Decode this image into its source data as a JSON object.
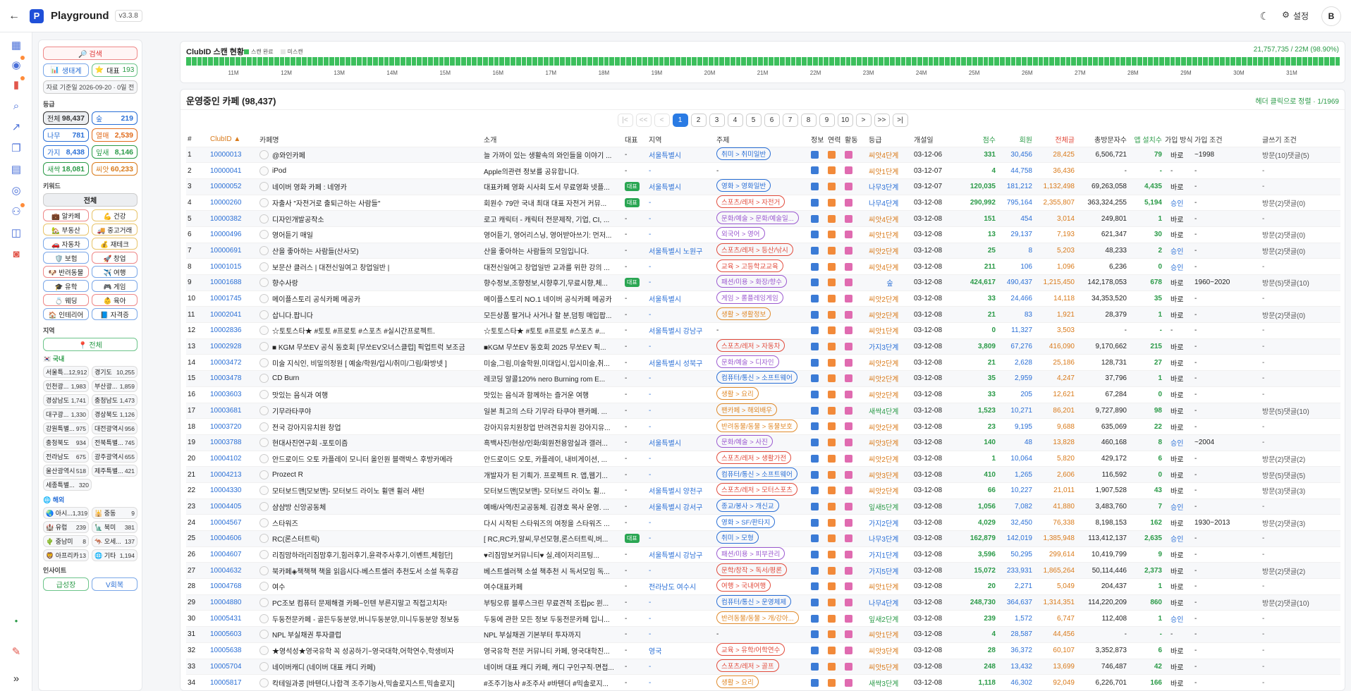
{
  "header": {
    "title": "Playground",
    "version": "v3.3.8",
    "settings_label": "설정",
    "avatar": "B"
  },
  "sidebar": {
    "search_label": "🔎 검색",
    "ecosystem_label": "생태계",
    "rep_label": "대표",
    "rep_count": "193",
    "data_date": "자료 기준일 2026-09-20 · 0일 전",
    "grade_title": "등급",
    "grades": [
      {
        "name": "전체",
        "count": "98,437",
        "color": "#333"
      },
      {
        "name": "숲",
        "count": "219",
        "color": "#2a6fd6"
      },
      {
        "name": "나무",
        "count": "781",
        "color": "#2a6fd6"
      },
      {
        "name": "열매",
        "count": "2,539",
        "color": "#e06a1a"
      },
      {
        "name": "가지",
        "count": "8,438",
        "color": "#2a6fd6"
      },
      {
        "name": "잎새",
        "count": "8,146",
        "color": "#2a9a47"
      },
      {
        "name": "새싹",
        "count": "18,081",
        "color": "#2a9a47"
      },
      {
        "name": "씨앗",
        "count": "60,233",
        "color": "#d97a1a"
      }
    ],
    "keyword_title": "키워드",
    "keyword_all": "전체",
    "keywords": [
      "💼 알카페",
      "💪 건강",
      "🏡 부동산",
      "🚚 중고거래",
      "🚗 자동차",
      "💰 재테크",
      "🛡️ 보험",
      "🚀 창업",
      "🐶 반려동물",
      "✈️ 여행",
      "🎓 유학",
      "🎮 게임",
      "💍 웨딩",
      "👶 육아",
      "🏠 인테리어",
      "📘 자격증"
    ],
    "region_title": "지역",
    "region_all": "📍 전체",
    "domestic_title": "🇰🇷 국내",
    "domestic": [
      {
        "name": "서울특...",
        "count": "12,912"
      },
      {
        "name": "경기도",
        "count": "10,255"
      },
      {
        "name": "인천광...",
        "count": "1,983"
      },
      {
        "name": "부산광...",
        "count": "1,859"
      },
      {
        "name": "경상남도",
        "count": "1,741"
      },
      {
        "name": "충청남도",
        "count": "1,473"
      },
      {
        "name": "대구광...",
        "count": "1,330"
      },
      {
        "name": "경상북도",
        "count": "1,126"
      },
      {
        "name": "강원특별...",
        "count": "975"
      },
      {
        "name": "대전광역시",
        "count": "956"
      },
      {
        "name": "충청북도",
        "count": "934"
      },
      {
        "name": "전북특별...",
        "count": "745"
      },
      {
        "name": "전라남도",
        "count": "675"
      },
      {
        "name": "광주광역시",
        "count": "655"
      },
      {
        "name": "울산광역시",
        "count": "518"
      },
      {
        "name": "제주특별...",
        "count": "421"
      },
      {
        "name": "세종특별...",
        "count": "320"
      }
    ],
    "overseas_title": "🌐 해외",
    "overseas": [
      {
        "name": "🌏 아시...",
        "count": "1,319"
      },
      {
        "name": "🕌 중동",
        "count": "9"
      },
      {
        "name": "🏰 유럽",
        "count": "239"
      },
      {
        "name": "🗽 북미",
        "count": "381"
      },
      {
        "name": "🌵 중남미",
        "count": "8"
      },
      {
        "name": "🦘 오세...",
        "count": "137"
      },
      {
        "name": "🦁 아프리카",
        "count": "13"
      },
      {
        "name": "🌐 기타",
        "count": "1,194"
      }
    ],
    "insight_title": "인사이트",
    "insight_buttons": [
      "급성장",
      "V회복"
    ]
  },
  "scan": {
    "title": "ClubID 스캔 현황",
    "legend_done": "스캔 완료",
    "legend_miss": "미스캔",
    "count": "21,757,735 / 22M (98.90%)",
    "ticks": [
      "11M",
      "12M",
      "13M",
      "14M",
      "15M",
      "16M",
      "17M",
      "18M",
      "19M",
      "20M",
      "21M",
      "22M",
      "23M",
      "24M",
      "25M",
      "26M",
      "27M",
      "28M",
      "29M",
      "30M",
      "31M"
    ]
  },
  "main": {
    "title": "운영중인 카페 (98,437)",
    "sort_hint": "헤더 클릭으로 정렬 · 1/1969",
    "pager": [
      "|<",
      "<<",
      "<",
      "1",
      "2",
      "3",
      "4",
      "5",
      "6",
      "7",
      "8",
      "9",
      "10",
      ">",
      ">>",
      ">|"
    ],
    "columns": [
      "#",
      "ClubID ▲",
      "카페명",
      "소개",
      "대표",
      "지역",
      "주제",
      "정보",
      "연력",
      "활동",
      "등급",
      "개설일",
      "점수",
      "회원",
      "전체글",
      "총방문자수",
      "앱 설치수",
      "가입 방식",
      "가입 조건",
      "글쓰기 조건"
    ],
    "rows": [
      [
        "1",
        "10000013",
        "@와인카페",
        "늘 가까이 있는 생활속의 와인들을 이야기 ...",
        "-",
        "서울특별시",
        "취미 > 취미일반",
        "씨앗4단계",
        "03-12-06",
        "331",
        "30,456",
        "28,425",
        "6,506,721",
        "79",
        "바로",
        "~1998",
        "방문(10)댓글(5)"
      ],
      [
        "2",
        "10000041",
        "iPod",
        "Apple의관련 정보를 공유합니다.",
        "-",
        "-",
        "-",
        "씨앗1단계",
        "03-12-07",
        "4",
        "44,758",
        "36,436",
        "-",
        "-",
        "-",
        "-",
        "-"
      ],
      [
        "3",
        "10000052",
        "네이버 영화 카페 : 네영카",
        "대표카페 영화 시사회 도서 무료영화 넷플...",
        "대표",
        "서울특별시",
        "영화 > 영화일반",
        "나무3단계",
        "03-12-07",
        "120,035",
        "181,212",
        "1,132,498",
        "69,263,058",
        "4,435",
        "바로",
        "-",
        "-"
      ],
      [
        "4",
        "10000260",
        "자출사 \"자전거로 출퇴근하는 사람들\"",
        "회원수 79만 국내 최대 대표 자전거 커뮤...",
        "대표",
        "-",
        "스포츠/레저 > 자전거",
        "나무4단계",
        "03-12-08",
        "290,992",
        "795,164",
        "2,355,807",
        "363,324,255",
        "5,194",
        "승인",
        "-",
        "방문(2)댓글(0)"
      ],
      [
        "5",
        "10000382",
        "디자인개발공작소",
        "로고 캐릭터 - 캐릭터 전문제작, 기업, CI, ...",
        "-",
        "-",
        "문화/예술 > 문화/예술일...",
        "씨앗4단계",
        "03-12-08",
        "151",
        "454",
        "3,014",
        "249,801",
        "1",
        "바로",
        "-",
        "-"
      ],
      [
        "6",
        "10000496",
        "영어듣기 매일",
        "영어듣기, 영어리스닝, 영어받아쓰기: 먼저...",
        "-",
        "-",
        "외국어 > 영어",
        "씨앗1단계",
        "03-12-08",
        "13",
        "29,137",
        "7,193",
        "621,347",
        "30",
        "바로",
        "-",
        "방문(2)댓글(0)"
      ],
      [
        "7",
        "10000691",
        "산을 좋아하는 사람들(산사모)",
        "산을 좋아하는 사람들의 모임입니다.",
        "-",
        "서울특별시 노원구",
        "스포츠/레저 > 등산/낚시",
        "씨앗2단계",
        "03-12-08",
        "25",
        "8",
        "5,203",
        "48,233",
        "2",
        "승인",
        "-",
        "방문(2)댓글(0)"
      ],
      [
        "8",
        "10001015",
        "보문산 클러스 | 대전신일여고 창업일반 |",
        "대전신일여고 창업일반 교과를 위한 강의 ...",
        "-",
        "-",
        "교육 > 고등학교교육",
        "씨앗4단계",
        "03-12-08",
        "211",
        "106",
        "1,096",
        "6,236",
        "0",
        "승인",
        "-",
        "-"
      ],
      [
        "9",
        "10001688",
        "향수사랑",
        "향수정보,조향정보,시향후기,무료시향,체...",
        "대표",
        "-",
        "패션/미용 > 화장/향수",
        "숲",
        "03-12-08",
        "424,617",
        "490,437",
        "1,215,450",
        "142,178,053",
        "678",
        "바로",
        "1960~2020",
        "방문(5)댓글(10)"
      ],
      [
        "10",
        "10001745",
        "메이플스토리 공식카페 메공카",
        "메이플스토리 NO.1 네이버 공식카페 메공카",
        "-",
        "서울특별시",
        "게임 > 롤플레잉게임",
        "씨앗2단계",
        "03-12-08",
        "33",
        "24,466",
        "14,118",
        "34,353,520",
        "35",
        "바로",
        "-",
        "-"
      ],
      [
        "11",
        "10002041",
        "삽니다.팝니다",
        "모든상품 팔거나 사거나 할 분,덤핑 매입팝...",
        "-",
        "-",
        "생활 > 생활정보",
        "씨앗2단계",
        "03-12-08",
        "21",
        "83",
        "1,921",
        "28,379",
        "1",
        "바로",
        "-",
        "방문(2)댓글(0)"
      ],
      [
        "12",
        "10002836",
        "☆토토스타★ #토토 #프로토 #스포츠 #실시간프로젝트.",
        "☆토토스타★ #토토 #프로토 #스포츠 #...",
        "-",
        "서울특별시 강남구",
        "-",
        "씨앗1단계",
        "03-12-08",
        "0",
        "11,327",
        "3,503",
        "-",
        "-",
        "-",
        "-",
        "-"
      ],
      [
        "13",
        "10002928",
        "■ KGM 무쏘EV 공식 동호회 [무쏘EV오너스클럽] 픽업트럭 보조금",
        "■KGM 무쏘EV 동호회 2025 무쏘EV 픽...",
        "-",
        "-",
        "스포츠/레저 > 자동차",
        "가지3단계",
        "03-12-08",
        "3,809",
        "67,276",
        "416,090",
        "9,170,662",
        "215",
        "바로",
        "-",
        "-"
      ],
      [
        "14",
        "10003472",
        "미술 지식인, 비밀의정원 [ 예술/학원/입시/취미/그림/화방넷 ]",
        "미술,그림,미술학원,미대입시,입시미술,취...",
        "-",
        "서울특별시 성북구",
        "문화/예술 > 디자인",
        "씨앗2단계",
        "03-12-08",
        "21",
        "2,628",
        "25,186",
        "128,731",
        "27",
        "바로",
        "-",
        "-"
      ],
      [
        "15",
        "10003478",
        "CD Burn",
        "레코딩 알콜120% nero Burning rom E...",
        "-",
        "-",
        "컴퓨터/통신 > 소프트웨어",
        "씨앗2단계",
        "03-12-08",
        "35",
        "2,959",
        "4,247",
        "37,796",
        "1",
        "바로",
        "-",
        "-"
      ],
      [
        "16",
        "10003603",
        "맛있는 음식과 여행",
        "맛있는 음식과 함께하는 즐거운 여행",
        "-",
        "-",
        "생활 > 요리",
        "씨앗2단계",
        "03-12-08",
        "33",
        "205",
        "12,621",
        "67,284",
        "0",
        "바로",
        "-",
        "-"
      ],
      [
        "17",
        "10003681",
        "기무라타쿠야",
        "일본 최고의 스타 기무라 타쿠야 팬카페. ...",
        "-",
        "-",
        "팬카페 > 해외배우",
        "새싹4단계",
        "03-12-08",
        "1,523",
        "10,271",
        "86,201",
        "9,727,890",
        "98",
        "바로",
        "-",
        "방문(5)댓글(10)"
      ],
      [
        "18",
        "10003720",
        "전국 강아지유치원 창업",
        "강아지유치원창업 반려견유치원 강아지유...",
        "-",
        "-",
        "반려동물/동물 > 동물보호",
        "씨앗2단계",
        "03-12-08",
        "23",
        "9,195",
        "9,688",
        "635,069",
        "22",
        "바로",
        "-",
        "-"
      ],
      [
        "19",
        "10003788",
        "현대사진연구회 -포토이즘",
        "흑백사진/현상/인화/회원전용암실과 갤러...",
        "-",
        "서울특별시",
        "문화/예술 > 사진",
        "씨앗3단계",
        "03-12-08",
        "140",
        "48",
        "13,828",
        "460,168",
        "8",
        "승인",
        "~2004",
        "-"
      ],
      [
        "20",
        "10004102",
        "안드로이드 오토 카플레이 모니터 올인원 블랙박스 후방카메라",
        "안드로이드 오토, 카플레이, 내비게이션, ...",
        "-",
        "-",
        "스포츠/레저 > 생활가전",
        "씨앗2단계",
        "03-12-08",
        "1",
        "10,064",
        "5,820",
        "429,172",
        "6",
        "바로",
        "-",
        "방문(2)댓글(2)"
      ],
      [
        "21",
        "10004213",
        "Prozect R",
        "개발자가 된 기획가. 프로젝트 R. 앱,웹기...",
        "-",
        "-",
        "컴퓨터/통신 > 소프트웨어",
        "씨앗3단계",
        "03-12-08",
        "410",
        "1,265",
        "2,606",
        "116,592",
        "0",
        "바로",
        "-",
        "방문(5)댓글(5)"
      ],
      [
        "22",
        "10004330",
        "모터보드맨[모보맨]- 모터보드 라이노 휠맨 휠러 새턴",
        "모터보드맨[모보맨]- 모터보드 라이노 휠...",
        "-",
        "서울특별시 양천구",
        "스포츠/레저 > 모터스포츠",
        "씨앗2단계",
        "03-12-08",
        "66",
        "10,227",
        "21,011",
        "1,907,528",
        "43",
        "바로",
        "-",
        "방문(3)댓글(3)"
      ],
      [
        "23",
        "10004405",
        "샴샴방 신앙공동체",
        "예배/사역/친교공동체. 김경호 목사 운영. ...",
        "-",
        "서울특별시 강서구",
        "종교/봉사 > 개신교",
        "잎새5단계",
        "03-12-08",
        "1,056",
        "7,082",
        "41,880",
        "3,483,760",
        "7",
        "승인",
        "-",
        "-"
      ],
      [
        "24",
        "10004567",
        "스타워즈",
        "다시 시작된 스타워즈의 여정을 스타워즈 ...",
        "-",
        "-",
        "영화 > SF/판타지",
        "가지2단계",
        "03-12-08",
        "4,029",
        "32,450",
        "76,338",
        "8,198,153",
        "162",
        "바로",
        "1930~2013",
        "방문(2)댓글(3)"
      ],
      [
        "25",
        "10004606",
        "RC(론스터트릭)",
        "[ RC,RC카,알씨,무선모형,론스터트릭,버...",
        "대표",
        "-",
        "취미 > 모형",
        "나무3단계",
        "03-12-08",
        "162,879",
        "142,019",
        "1,385,948",
        "113,412,137",
        "2,635",
        "승인",
        "-",
        "-"
      ],
      [
        "26",
        "10004607",
        "리짐맘하라[리짐맘후기,힘러후기,윤곽주사후기,이벤트,체험단]",
        "♥리짐맘보커뮤니티♥ 실,레이저리프팅...",
        "-",
        "서울특별시 강남구",
        "패션/미용 > 피부관리",
        "가지1단계",
        "03-12-08",
        "3,596",
        "50,295",
        "299,614",
        "10,419,799",
        "9",
        "바로",
        "-",
        "-"
      ],
      [
        "27",
        "10004632",
        "북카페◈책책책 책을 읽읍시다-베스트셀러 추천도서 소설 독후감",
        "베스트셀러책 소설 책추천 시 독서모임 독...",
        "-",
        "-",
        "문학/창작 > 독서/평론",
        "가지5단계",
        "03-12-08",
        "15,072",
        "233,931",
        "1,865,264",
        "50,114,446",
        "2,373",
        "바로",
        "-",
        "방문(2)댓글(2)"
      ],
      [
        "28",
        "10004768",
        "여수",
        "여수대표카페",
        "-",
        "전라남도 여수시",
        "여행 > 국내여행",
        "씨앗1단계",
        "03-12-08",
        "20",
        "2,271",
        "5,049",
        "204,437",
        "1",
        "바로",
        "-",
        "-"
      ],
      [
        "29",
        "10004880",
        "PC조보 컴퓨터 문제해결 카페~인텐 부른지말고 직접고치자!",
        "부팅오류 블루스크린 무료견적 조립pc 윈...",
        "-",
        "-",
        "컴퓨터/통신 > 운영체제",
        "나무4단계",
        "03-12-08",
        "248,730",
        "364,637",
        "1,314,351",
        "114,220,209",
        "860",
        "바로",
        "-",
        "방문(2)댓글(10)"
      ],
      [
        "30",
        "10005431",
        "두둥전문카페 - 골든두둥분양,버니두둥분양,미니두둥분양 정보동",
        "두둥에 관한 모든 정보 두둥전문카페 입니...",
        "-",
        "-",
        "반려동물/동물 > 개/강아...",
        "잎새2단계",
        "03-12-08",
        "239",
        "1,572",
        "6,747",
        "112,408",
        "1",
        "승인",
        "-",
        "-"
      ],
      [
        "31",
        "10005603",
        "NPL 부실채권 투자클럽",
        "NPL 부실채권 기본부터 투자까지",
        "-",
        "-",
        "-",
        "씨앗1단계",
        "03-12-08",
        "4",
        "28,587",
        "44,456",
        "-",
        "-",
        "-",
        "-",
        "-"
      ],
      [
        "32",
        "10005638",
        "★영석성★영국유학 꼭 성공하기~영국대학,어학연수,학생비자",
        "영국유학 전문 커뮤니티 카페, 영국대학진...",
        "-",
        "영국",
        "교육 > 유학/어학연수",
        "씨앗3단계",
        "03-12-08",
        "28",
        "36,372",
        "60,107",
        "3,352,873",
        "6",
        "바로",
        "-",
        "-"
      ],
      [
        "33",
        "10005704",
        "네이버캐디 (네이버 대표 캐디 카페)",
        "네이버 대표 캐디 카페, 캐디 구인구직·면접...",
        "-",
        "-",
        "스포츠/레저 > 골프",
        "씨앗5단계",
        "03-12-08",
        "248",
        "13,432",
        "13,699",
        "746,487",
        "42",
        "바로",
        "-",
        "-"
      ],
      [
        "34",
        "10005817",
        "칵테일과콩 [바텐더,나합격 조주기능사,믹솔로지스트,믹솔로지]",
        "#조주기능사 #조주사 #바텐더 #믹솔로지...",
        "-",
        "-",
        "생활 > 요리",
        "새싹3단계",
        "03-12-08",
        "1,118",
        "46,302",
        "92,049",
        "6,226,701",
        "166",
        "바로",
        "-",
        "-"
      ]
    ]
  },
  "colors": {
    "accent": "#2a7be4",
    "green": "#3cbf5c",
    "red": "#e2574c"
  }
}
